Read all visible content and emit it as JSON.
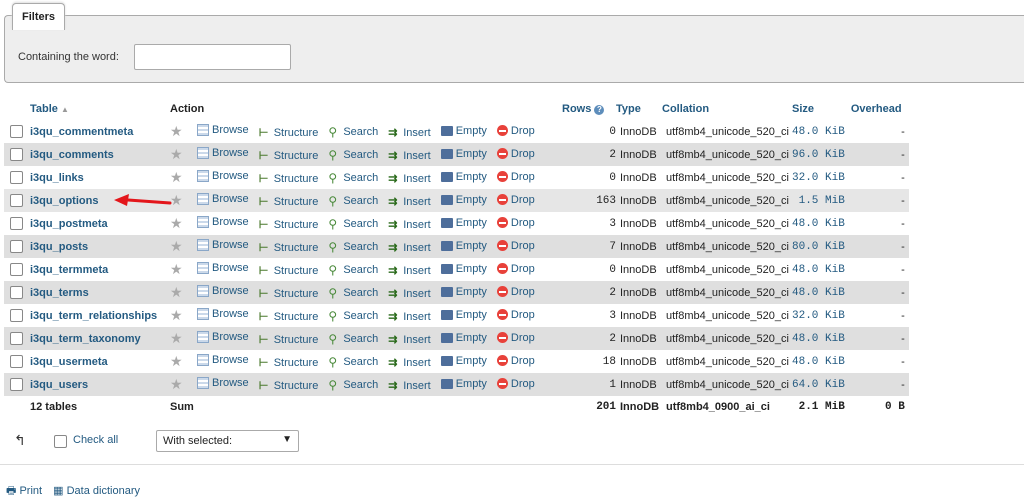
{
  "filters": {
    "legend": "Filters",
    "containing_label": "Containing the word:",
    "containing_value": ""
  },
  "table": {
    "headers": {
      "table": "Table",
      "action": "Action",
      "rows": "Rows",
      "type": "Type",
      "collation": "Collation",
      "size": "Size",
      "overhead": "Overhead"
    },
    "actions": {
      "browse": "Browse",
      "structure": "Structure",
      "search": "Search",
      "insert": "Insert",
      "empty": "Empty",
      "drop": "Drop"
    },
    "rows": [
      {
        "name": "i3qu_commentmeta",
        "rows": "0",
        "type": "InnoDB",
        "collation": "utf8mb4_unicode_520_ci",
        "size": "48.0 KiB",
        "overhead": "-"
      },
      {
        "name": "i3qu_comments",
        "rows": "2",
        "type": "InnoDB",
        "collation": "utf8mb4_unicode_520_ci",
        "size": "96.0 KiB",
        "overhead": "-"
      },
      {
        "name": "i3qu_links",
        "rows": "0",
        "type": "InnoDB",
        "collation": "utf8mb4_unicode_520_ci",
        "size": "32.0 KiB",
        "overhead": "-"
      },
      {
        "name": "i3qu_options",
        "rows": "163",
        "type": "InnoDB",
        "collation": "utf8mb4_unicode_520_ci",
        "size": "1.5 MiB",
        "overhead": "-"
      },
      {
        "name": "i3qu_postmeta",
        "rows": "3",
        "type": "InnoDB",
        "collation": "utf8mb4_unicode_520_ci",
        "size": "48.0 KiB",
        "overhead": "-"
      },
      {
        "name": "i3qu_posts",
        "rows": "7",
        "type": "InnoDB",
        "collation": "utf8mb4_unicode_520_ci",
        "size": "80.0 KiB",
        "overhead": "-"
      },
      {
        "name": "i3qu_termmeta",
        "rows": "0",
        "type": "InnoDB",
        "collation": "utf8mb4_unicode_520_ci",
        "size": "48.0 KiB",
        "overhead": "-"
      },
      {
        "name": "i3qu_terms",
        "rows": "2",
        "type": "InnoDB",
        "collation": "utf8mb4_unicode_520_ci",
        "size": "48.0 KiB",
        "overhead": "-"
      },
      {
        "name": "i3qu_term_relationships",
        "rows": "3",
        "type": "InnoDB",
        "collation": "utf8mb4_unicode_520_ci",
        "size": "32.0 KiB",
        "overhead": "-"
      },
      {
        "name": "i3qu_term_taxonomy",
        "rows": "2",
        "type": "InnoDB",
        "collation": "utf8mb4_unicode_520_ci",
        "size": "48.0 KiB",
        "overhead": "-"
      },
      {
        "name": "i3qu_usermeta",
        "rows": "18",
        "type": "InnoDB",
        "collation": "utf8mb4_unicode_520_ci",
        "size": "48.0 KiB",
        "overhead": "-"
      },
      {
        "name": "i3qu_users",
        "rows": "1",
        "type": "InnoDB",
        "collation": "utf8mb4_unicode_520_ci",
        "size": "64.0 KiB",
        "overhead": "-"
      }
    ],
    "footer": {
      "count": "12 tables",
      "sum": "Sum",
      "rows": "201",
      "type": "InnoDB",
      "collation": "utf8mb4_0900_ai_ci",
      "size": "2.1 MiB",
      "overhead": "0 B"
    }
  },
  "bulk": {
    "check_all": "Check all",
    "with_selected": "With selected:"
  },
  "links": {
    "print": "Print",
    "data_dictionary": "Data dictionary"
  },
  "icons": {
    "favorite": "star-icon",
    "browse": "browse-icon",
    "structure": "structure-icon",
    "search": "search-icon",
    "insert": "insert-icon",
    "empty": "empty-icon",
    "drop": "drop-icon",
    "print": "printer-icon",
    "dictionary": "dictionary-icon"
  },
  "colors": {
    "link": "#235a81",
    "drop": "#e8413a",
    "annotation_arrow": "#e3161b"
  }
}
